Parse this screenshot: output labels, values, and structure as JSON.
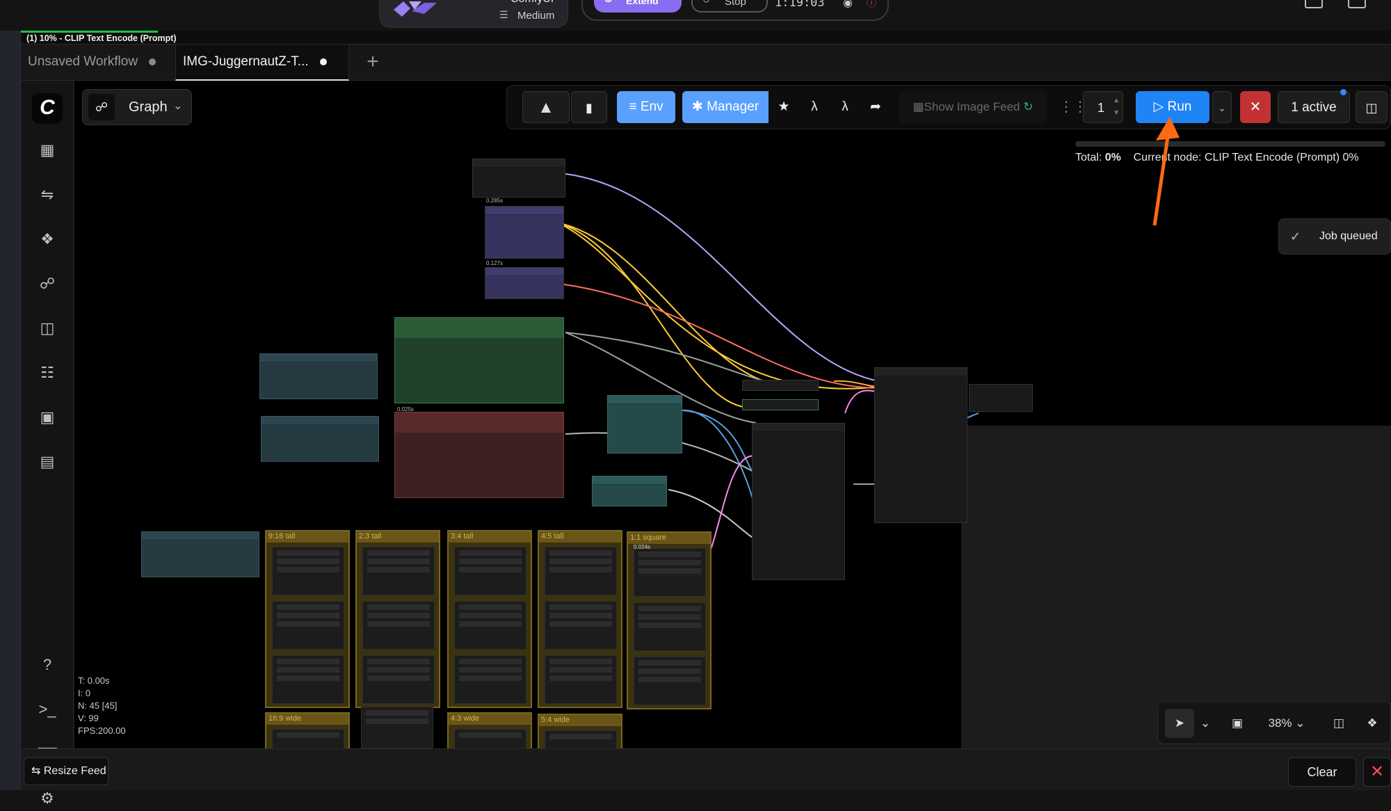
{
  "header": {
    "app_name": "ComfyUI",
    "machine_tier": "Medium",
    "extend_label": "Extend",
    "stop_label": "Stop",
    "timer": "1:19:03"
  },
  "progress": {
    "text": "(1) 10% - CLIP Text Encode (Prompt)",
    "percent": 10
  },
  "tabs": [
    {
      "label": "Unsaved Workflow"
    },
    {
      "label": "IMG-JuggernautZ-T..."
    }
  ],
  "tab_add": "+",
  "graph_menu": {
    "label": "Graph"
  },
  "toolbar": {
    "env_label": "Env",
    "manager_label": "Manager",
    "feed_label": "Show Image Feed",
    "batch_count": "1",
    "run_label": "Run",
    "active_label": "1 active"
  },
  "run_status": {
    "total_label": "Total:",
    "total_value": "0%",
    "current_node": "Current node: CLIP Text Encode (Prompt) 0%"
  },
  "toast": {
    "message": "Job queued"
  },
  "groups": [
    {
      "label": "9:16 tall"
    },
    {
      "label": "2:3 tall"
    },
    {
      "label": "3:4 tall"
    },
    {
      "label": "4:5 tall"
    },
    {
      "label": "1:1 square"
    },
    {
      "label": "16:9 wide"
    },
    {
      "label": "4:3 wide"
    },
    {
      "label": "5:4  wide"
    }
  ],
  "node_timings": [
    "0.285s",
    "0.127s",
    "0.025s",
    "0.024s"
  ],
  "stats": {
    "t": "T: 0.00s",
    "i": "I: 0",
    "n": "N: 45 [45]",
    "v": "V: 99",
    "fps": "FPS:200.00"
  },
  "canvas_controls": {
    "zoom": "38%"
  },
  "bottom": {
    "resize_label": "Resize Feed",
    "clear_label": "Clear"
  },
  "colors": {
    "run_button": "#1f84f5",
    "env_manager": "#5aa0ff",
    "cancel": "#c23234",
    "progress": "#1fc24b",
    "annotation_arrow": "#ff6a13"
  }
}
